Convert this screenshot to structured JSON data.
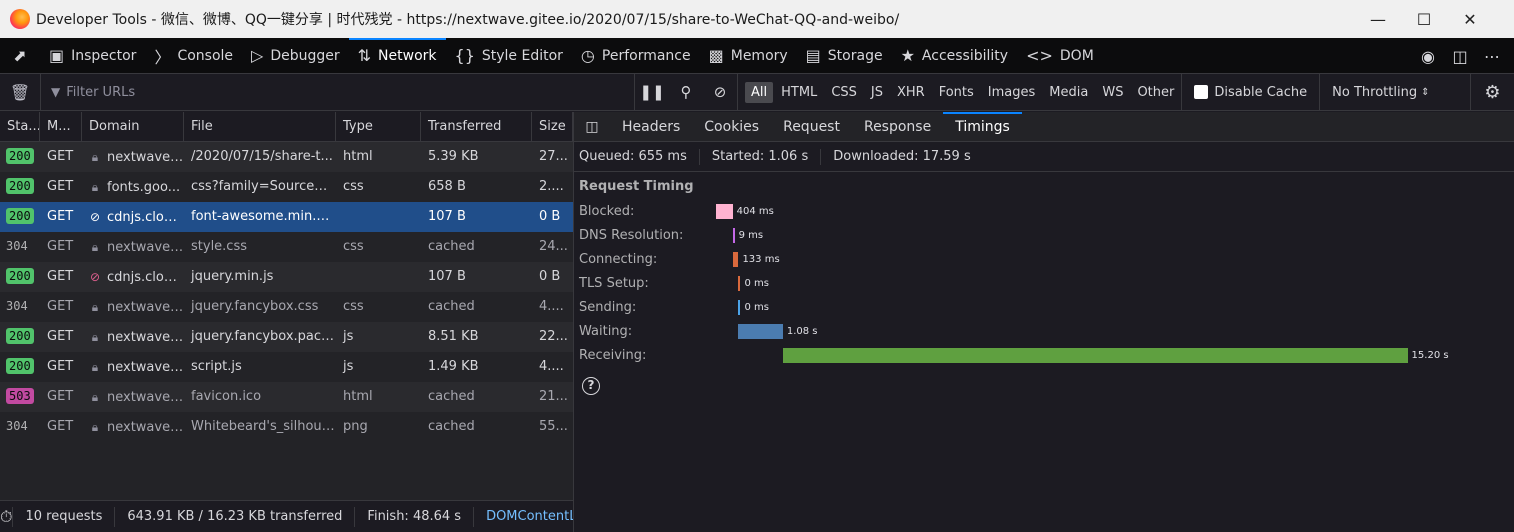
{
  "window": {
    "title": "Developer Tools - 微信、微博、QQ一键分享 | 时代残党 - https://nextwave.gitee.io/2020/07/15/share-to-WeChat-QQ-and-weibo/"
  },
  "tools": [
    {
      "label": "Inspector",
      "icon": "inspector-icon"
    },
    {
      "label": "Console",
      "icon": "console-icon"
    },
    {
      "label": "Debugger",
      "icon": "debugger-icon"
    },
    {
      "label": "Network",
      "icon": "network-icon"
    },
    {
      "label": "Style Editor",
      "icon": "style-editor-icon"
    },
    {
      "label": "Performance",
      "icon": "performance-icon"
    },
    {
      "label": "Memory",
      "icon": "memory-icon"
    },
    {
      "label": "Storage",
      "icon": "storage-icon"
    },
    {
      "label": "Accessibility",
      "icon": "accessibility-icon"
    },
    {
      "label": "DOM",
      "icon": "dom-icon"
    }
  ],
  "filter": {
    "placeholder": "Filter URLs",
    "types": [
      "All",
      "HTML",
      "CSS",
      "JS",
      "XHR",
      "Fonts",
      "Images",
      "Media",
      "WS",
      "Other"
    ],
    "selected_type": "All",
    "disable_cache": "Disable Cache",
    "throttling": "No Throttling"
  },
  "table": {
    "headers": [
      "Sta...",
      "M...",
      "Domain",
      "File",
      "Type",
      "Transferred",
      "Size"
    ],
    "rows": [
      {
        "status": "200",
        "method": "GET",
        "domain": "nextwave....",
        "file": "/2020/07/15/share-t...",
        "type": "html",
        "transferred": "5.39 KB",
        "size": "27..."
      },
      {
        "status": "200",
        "method": "GET",
        "domain": "fonts.goo...",
        "file": "css?family=Source+...",
        "type": "css",
        "transferred": "658 B",
        "size": "2...."
      },
      {
        "status": "200",
        "method": "GET",
        "domain": "cdnjs.clou...",
        "file": "font-awesome.min.css",
        "type": "",
        "transferred": "107 B",
        "size": "0 B"
      },
      {
        "status": "304",
        "method": "GET",
        "domain": "nextwave....",
        "file": "style.css",
        "type": "css",
        "transferred": "cached",
        "size": "24..."
      },
      {
        "status": "200",
        "method": "GET",
        "domain": "cdnjs.clou...",
        "file": "jquery.min.js",
        "type": "",
        "transferred": "107 B",
        "size": "0 B"
      },
      {
        "status": "304",
        "method": "GET",
        "domain": "nextwave....",
        "file": "jquery.fancybox.css",
        "type": "css",
        "transferred": "cached",
        "size": "4...."
      },
      {
        "status": "200",
        "method": "GET",
        "domain": "nextwave....",
        "file": "jquery.fancybox.pack.js",
        "type": "js",
        "transferred": "8.51 KB",
        "size": "22..."
      },
      {
        "status": "200",
        "method": "GET",
        "domain": "nextwave....",
        "file": "script.js",
        "type": "js",
        "transferred": "1.49 KB",
        "size": "4...."
      },
      {
        "status": "503",
        "method": "GET",
        "domain": "nextwave....",
        "file": "favicon.ico",
        "type": "html",
        "transferred": "cached",
        "size": "21..."
      },
      {
        "status": "304",
        "method": "GET",
        "domain": "nextwave....",
        "file": "Whitebeard's_silhoue...",
        "type": "png",
        "transferred": "cached",
        "size": "55..."
      }
    ]
  },
  "statusbar": {
    "requests": "10 requests",
    "transferred": "643.91 KB / 16.23 KB transferred",
    "finish": "Finish: 48.64 s",
    "dom": "DOMContentLoaded"
  },
  "details": {
    "tabs": [
      "Headers",
      "Cookies",
      "Request",
      "Response",
      "Timings"
    ],
    "active_tab": "Timings",
    "queued": "Queued: 655 ms",
    "started": "Started: 1.06 s",
    "downloaded": "Downloaded: 17.59 s",
    "timing_title": "Request Timing",
    "timings": [
      {
        "label": "Blocked:",
        "value": "404 ms",
        "color": "#ffb3d1"
      },
      {
        "label": "DNS Resolution:",
        "value": "9 ms",
        "color": "#c468e8"
      },
      {
        "label": "Connecting:",
        "value": "133 ms",
        "color": "#d9693d"
      },
      {
        "label": "TLS Setup:",
        "value": "0 ms",
        "color": "#d9693d"
      },
      {
        "label": "Sending:",
        "value": "0 ms",
        "color": "#4ba3e8"
      },
      {
        "label": "Waiting:",
        "value": "1.08 s",
        "color": "#4b7cb0"
      },
      {
        "label": "Receiving:",
        "value": "15.20 s",
        "color": "#5fa040"
      }
    ]
  }
}
